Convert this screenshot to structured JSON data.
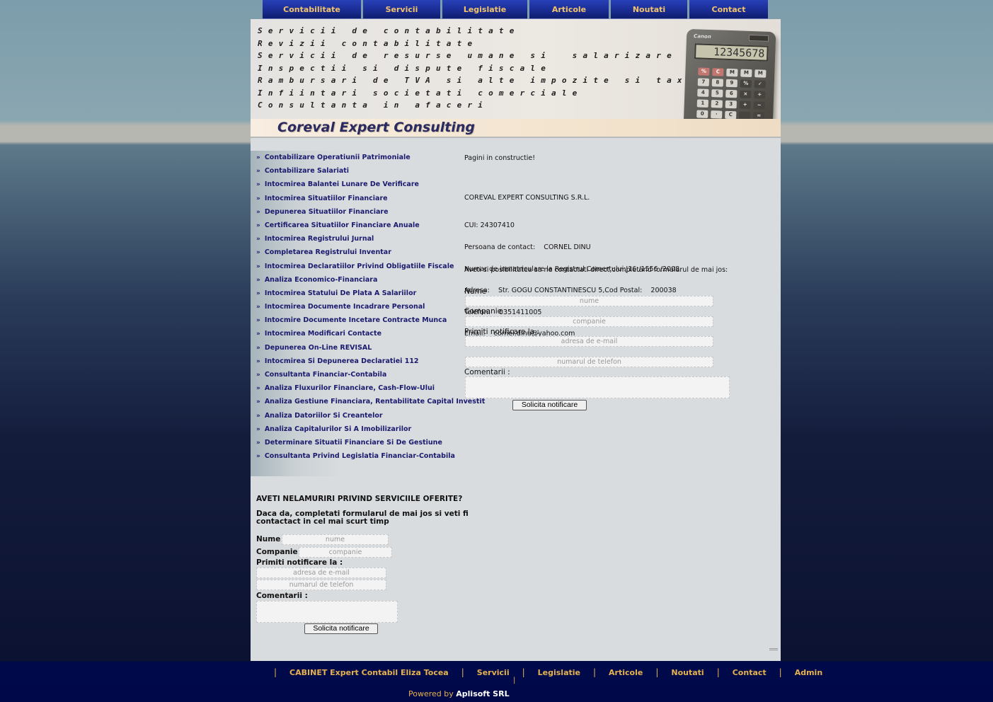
{
  "topnav": [
    {
      "label": "Contabilitate",
      "w": 139
    },
    {
      "label": "Servicii",
      "w": 109
    },
    {
      "label": "Legislatie",
      "w": 120
    },
    {
      "label": "Articole",
      "w": 112
    },
    {
      "label": "Noutati",
      "w": 108
    },
    {
      "label": "Contact",
      "w": 111
    }
  ],
  "banner": {
    "lines": [
      "Servicii de contabilitate",
      "Revizii contabilitate",
      "Servicii de resurse umane si  salarizare",
      "Inspectii si dispute fiscale",
      "Rambursari de TVA si alte impozite si taxe",
      "Infiintari societati comerciale",
      "Consultanta in afaceri"
    ],
    "logo": "Coreval Expert Consulting",
    "calculator_brand": "Canon",
    "calculator_display": "12345678"
  },
  "sidebar": {
    "items": [
      "Contabilizare Operatiunii Patrimoniale",
      "Contabilizare Salariati",
      "Intocmirea Balantei Lunare De Verificare",
      "Intocmirea Situatiilor Financiare",
      "Depunerea Situatiilor Financiare",
      "Certificarea Situatiilor Financiare Anuale",
      "Intocmirea Registrului Jurnal",
      "Completarea Registrului Inventar",
      "Intocmirea Declaratiilor Privind Obligatiile Fiscale",
      "Analiza Economico-Financiara",
      "Intocmirea Statului De Plata A Salariilor",
      "Intocmirea Documente Incadrare Personal",
      "Intocmire Documente Incetare Contracte Munca",
      "Intocmirea Modificari Contacte",
      "Depunerea On-Line REVISAL",
      "Intocmirea Si Depunerea Declaratiei 112",
      "Consultanta Financiar-Contabila",
      "Analiza Fluxurilor Financiare, Cash-Flow-Ului",
      "Analiza Gestiune Financiara, Rentabilitate Capital Investit",
      "Analiza Datoriilor Si Creantelor",
      "Analiza Capitalurilor Si A Imobilizarilor",
      "Determinare Situatii Financiare Si De Gestiune",
      "Consultanta Privind Legislatia Financiar-Contabila"
    ]
  },
  "left_form": {
    "heading": "AVETI NELAMURIRI PRIVIND SERVICIILE OFERITE?",
    "intro_1": "Daca da, completati formularul de mai jos si veti fi",
    "intro_2": "contactact in cel mai scurt timp",
    "name_label": "Nume",
    "name_ph": "nume",
    "company_label": "Companie",
    "company_ph": "companie",
    "notify_label": "Primiti notificare la :",
    "email_ph": "adresa de e-mail",
    "phone_ph": "numarul de telefon",
    "comments_label": "Comentarii :",
    "submit": "Solicita notificare"
  },
  "content": {
    "construction": "Pagini in constructie!",
    "company": "COREVAL EXPERT CONSULTING S.R.L.",
    "cui": "CUI: 24307410",
    "contact_person": "Persoana de contact:    CORNEL DINU",
    "registry": "Numar de inmatriculare la Registrul Comertului:J16 /1556 /2008",
    "address": "Adresa:    Str. GOGU CONSTANTINESCU 5,Cod Postal:    200038",
    "phone": "Telefon:    0351411005",
    "email": "Email:    cornel.dinu@yahoo.com",
    "possibility": "Aveti si posibilitatea sa ne contactati direct,completand formularul de mai jos:"
  },
  "right_form": {
    "name_label": "Nume",
    "name_ph": "nume",
    "company_label": "Companie",
    "company_ph": "companie",
    "notify_label": "Primiti notificare la :",
    "email_ph": "adresa de e-mail",
    "phone_ph": "numarul de telefon",
    "comments_label": "Comentarii :",
    "submit": "Solicita notificare"
  },
  "footer": {
    "links": [
      "CABINET Expert Contabil Eliza Tocea",
      "Servicii",
      "Legislatie",
      "Articole",
      "Noutati",
      "Contact",
      "Admin"
    ],
    "powered_prefix": "Powered by",
    "powered_company": "Aplisoft SRL"
  }
}
